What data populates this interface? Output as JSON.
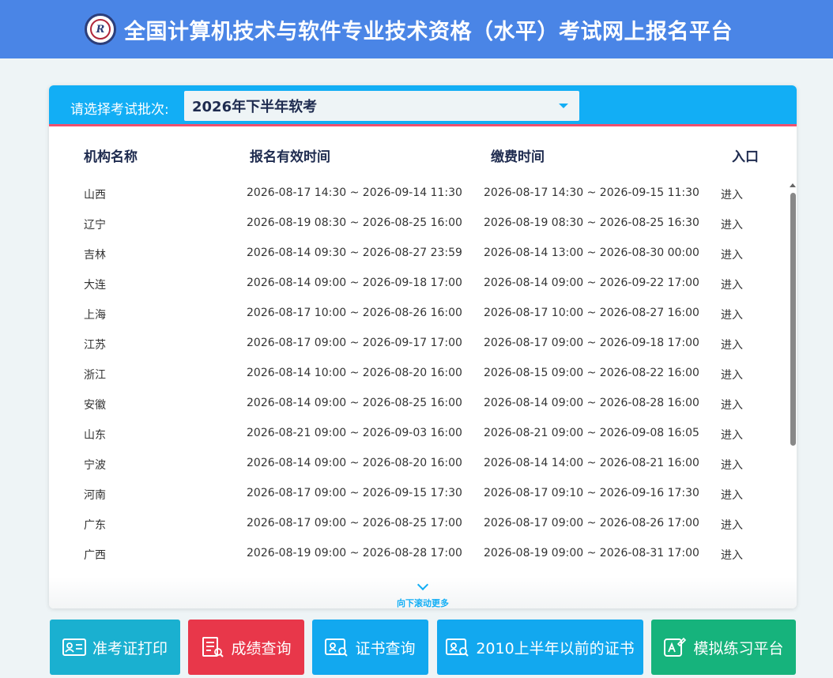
{
  "header": {
    "logo_text": "R",
    "title": "全国计算机技术与软件专业技术资格（水平）考试网上报名平台"
  },
  "selector": {
    "label": "请选择考试批次:",
    "selected": "2026年下半年软考"
  },
  "table": {
    "headers": [
      "机构名称",
      "报名有效时间",
      "缴费时间",
      "入口"
    ],
    "rows": [
      [
        "山西",
        "2026-08-17 14:30 ~ 2026-09-14 11:30",
        "2026-08-17 14:30 ~ 2026-09-15 11:30",
        "进入"
      ],
      [
        "辽宁",
        "2026-08-19 08:30 ~ 2026-08-25 16:00",
        "2026-08-19 08:30 ~ 2026-08-25 16:30",
        "进入"
      ],
      [
        "吉林",
        "2026-08-14 09:30 ~ 2026-08-27 23:59",
        "2026-08-14 13:00 ~ 2026-08-30 00:00",
        "进入"
      ],
      [
        "大连",
        "2026-08-14 09:00 ~ 2026-09-18 17:00",
        "2026-08-14 09:00 ~ 2026-09-22 17:00",
        "进入"
      ],
      [
        "上海",
        "2026-08-17 10:00 ~ 2026-08-26 16:00",
        "2026-08-17 10:00 ~ 2026-08-27 16:00",
        "进入"
      ],
      [
        "江苏",
        "2026-08-17 09:00 ~ 2026-09-17 17:00",
        "2026-08-17 09:00 ~ 2026-09-18 17:00",
        "进入"
      ],
      [
        "浙江",
        "2026-08-14 10:00 ~ 2026-08-20 16:00",
        "2026-08-15 09:00 ~ 2026-08-22 16:00",
        "进入"
      ],
      [
        "安徽",
        "2026-08-14 09:00 ~ 2026-08-25 16:00",
        "2026-08-14 09:00 ~ 2026-08-28 16:00",
        "进入"
      ],
      [
        "山东",
        "2026-08-21 09:00 ~ 2026-09-03 16:00",
        "2026-08-21 09:00 ~ 2026-09-08 16:05",
        "进入"
      ],
      [
        "宁波",
        "2026-08-14 09:00 ~ 2026-08-20 16:00",
        "2026-08-14 14:00 ~ 2026-08-21 16:00",
        "进入"
      ],
      [
        "河南",
        "2026-08-17 09:00 ~ 2026-09-15 17:30",
        "2026-08-17 09:10 ~ 2026-09-16 17:30",
        "进入"
      ],
      [
        "广东",
        "2026-08-17 09:00 ~ 2026-08-25 17:00",
        "2026-08-17 09:00 ~ 2026-08-26 17:00",
        "进入"
      ],
      [
        "广西",
        "2026-08-19 09:00 ~ 2026-08-28 17:00",
        "2026-08-19 09:00 ~ 2026-08-31 17:00",
        "进入"
      ]
    ]
  },
  "scroll_more": "向下滚动更多",
  "buttons": [
    {
      "label": "准考证打印",
      "color": "#1ab0d0",
      "icon": "id-card-icon"
    },
    {
      "label": "成绩查询",
      "color": "#e8374a",
      "icon": "report-search-icon"
    },
    {
      "label": "证书查询",
      "color": "#12a8ef",
      "icon": "certificate-search-icon"
    },
    {
      "label": "2010上半年以前的证书",
      "color": "#12a8ef",
      "icon": "certificate-search-icon"
    },
    {
      "label": "模拟练习平台",
      "color": "#16b37c",
      "icon": "edit-practice-icon"
    }
  ],
  "colors": {
    "header_bg": "#4a85e6",
    "panel_top_bg": "#12aef5",
    "accent_line": "#f0506e"
  }
}
